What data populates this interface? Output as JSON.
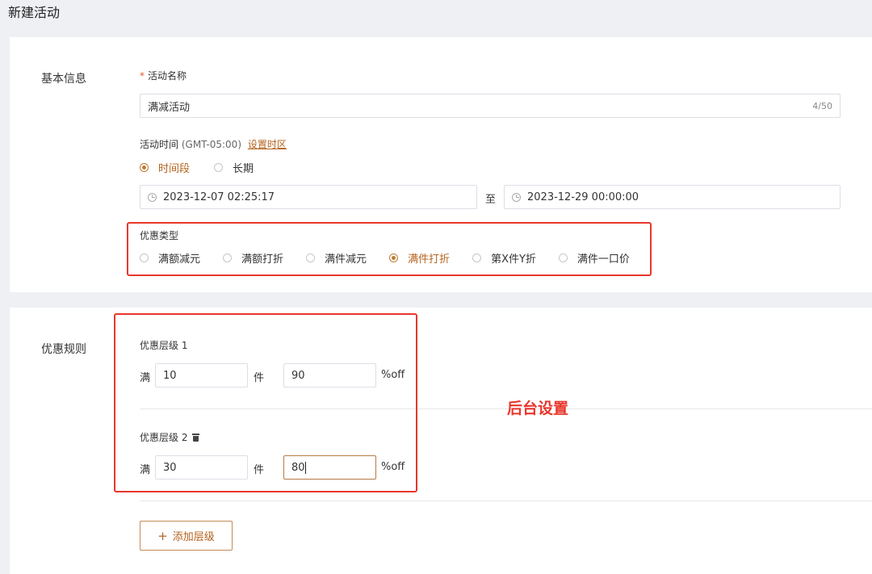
{
  "page": {
    "title": "新建活动"
  },
  "basic": {
    "section_label": "基本信息",
    "name_required_mark": "*",
    "name_label": "活动名称",
    "name_value": "满减活动",
    "name_counter": "4/50",
    "time_label": "活动时间",
    "timezone": "(GMT-05:00)",
    "set_timezone_link": "设置时区",
    "time_options": [
      {
        "label": "时间段",
        "selected": true
      },
      {
        "label": "长期",
        "selected": false
      }
    ],
    "start_date": "2023-12-07 02:25:17",
    "range_separator": "至",
    "end_date": "2023-12-29 00:00:00"
  },
  "discount_type": {
    "label": "优惠类型",
    "options": [
      {
        "label": "满额减元",
        "selected": false
      },
      {
        "label": "满额打折",
        "selected": false
      },
      {
        "label": "满件减元",
        "selected": false
      },
      {
        "label": "满件打折",
        "selected": true
      },
      {
        "label": "第X件Y折",
        "selected": false
      },
      {
        "label": "满件一口价",
        "selected": false
      }
    ]
  },
  "rules": {
    "section_label": "优惠规则",
    "tiers": [
      {
        "title": "优惠层级 1",
        "prefix": "满",
        "quantity": "10",
        "unit": "件",
        "percent": "90",
        "suffix": "%off",
        "deletable": false
      },
      {
        "title": "优惠层级 2",
        "prefix": "满",
        "quantity": "30",
        "unit": "件",
        "percent": "80",
        "suffix": "%off",
        "deletable": true
      }
    ],
    "add_tier_button": "添加层级"
  },
  "annotation": {
    "text": "后台设置",
    "color": "#e9362c"
  },
  "colors": {
    "accent": "#b5631e",
    "annotation_border": "#e9362c"
  }
}
